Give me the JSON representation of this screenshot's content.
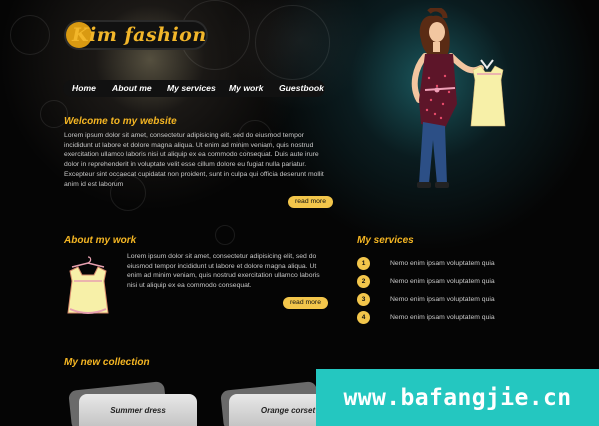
{
  "brand": {
    "logo_text": "Kim fashion"
  },
  "nav": {
    "items": [
      "Home",
      "About me",
      "My services",
      "My work",
      "Guestbook"
    ]
  },
  "welcome": {
    "title": "Welcome to my website",
    "body": "Lorem ipsum dolor sit amet, consectetur adipisicing elit, sed do eiusmod tempor incididunt ut labore et dolore magna aliqua. Ut enim ad minim veniam, quis nostrud exercitation ullamco laboris nisi ut aliquip ex ea commodo consequat. Duis aute irure dolor in reprehenderit in voluptate velit esse cillum dolore eu fugiat nulla pariatur. Excepteur sint occaecat cupidatat non proident, sunt in culpa qui officia deserunt mollit anim id est laborum",
    "button": "read more"
  },
  "about": {
    "title": "About my work",
    "body": "Lorem ipsum dolor sit amet, consectetur adipisicing elit, sed do eiusmod tempor incididunt ut labore et dolore magna aliqua. Ut enim ad minim veniam, quis nostrud exercitation ullamco laboris nisi ut aliquip ex ea commodo consequat.",
    "button": "read more"
  },
  "services": {
    "title": "My services",
    "items": [
      {
        "num": "1",
        "text": "Nemo enim ipsam voluptatem quia"
      },
      {
        "num": "2",
        "text": "Nemo enim ipsam voluptatem quia"
      },
      {
        "num": "3",
        "text": "Nemo enim ipsam voluptatem quia"
      },
      {
        "num": "4",
        "text": "Nemo enim ipsam voluptatem quia"
      }
    ]
  },
  "collection": {
    "title": "My new collection",
    "cards": [
      "Summer dress",
      "Orange corset"
    ]
  },
  "watermark": {
    "text": "www.bafangjie.cn"
  },
  "colors": {
    "accent": "#f5b623",
    "button": "#f3c64b",
    "watermark_bg": "#24c7c0"
  }
}
